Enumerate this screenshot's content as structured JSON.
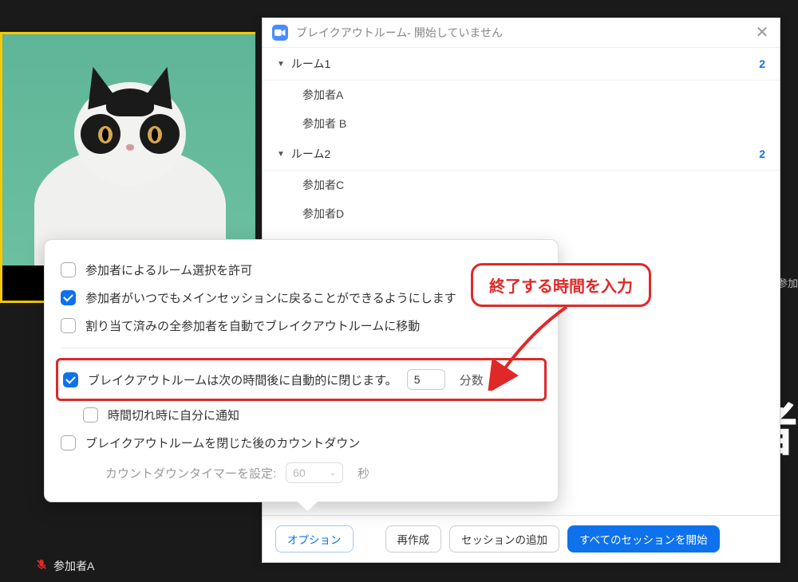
{
  "dialog": {
    "title": "ブレイクアウトルーム- 開始していません",
    "rooms": [
      {
        "name": "ルーム1",
        "count": "2",
        "participants": [
          "参加者A",
          "参加者 B"
        ]
      },
      {
        "name": "ルーム2",
        "count": "2",
        "participants": [
          "参加者C",
          "参加者D"
        ]
      }
    ],
    "footer": {
      "options": "オプション",
      "recreate": "再作成",
      "add_session": "セッションの追加",
      "start_all": "すべてのセッションを開始"
    }
  },
  "video": {
    "participant_name": "参加者A"
  },
  "options": {
    "allow_choose": "参加者によるルーム選択を許可",
    "allow_return": "参加者がいつでもメインセッションに戻ることができるようにします",
    "auto_move": "割り当て済みの全参加者を自動でブレイクアウトルームに移動",
    "auto_close_label": "ブレイクアウトルームは次の時間後に自動的に閉じます。",
    "auto_close_value": "5",
    "auto_close_unit": "分数",
    "notify_timeout": "時間切れ時に自分に通知",
    "countdown_after_close": "ブレイクアウトルームを閉じた後のカウントダウン",
    "countdown_timer_label": "カウントダウンタイマーを設定:",
    "countdown_timer_value": "60",
    "countdown_timer_unit": "秒"
  },
  "annotation": {
    "text": "終了する時間を入力"
  },
  "bg": {
    "big_text": "者",
    "toolbar_item": "参加"
  }
}
